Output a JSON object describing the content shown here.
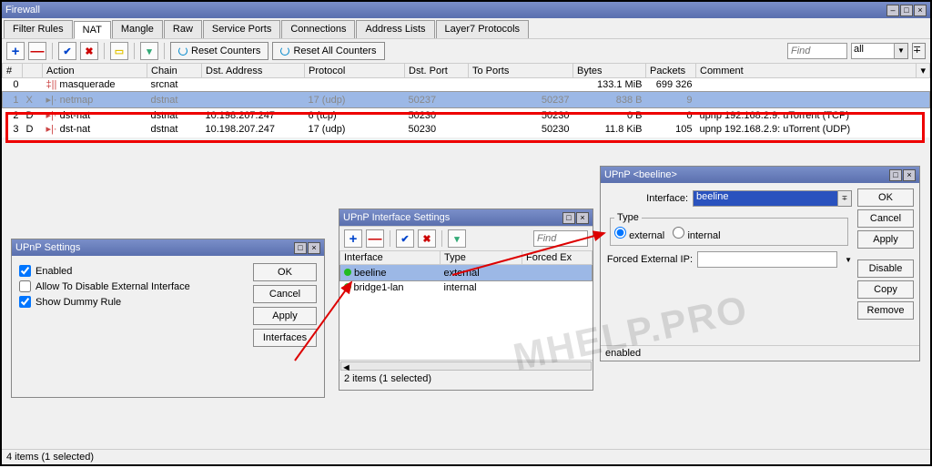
{
  "main": {
    "title": "Firewall",
    "tabs": [
      "Filter Rules",
      "NAT",
      "Mangle",
      "Raw",
      "Service Ports",
      "Connections",
      "Address Lists",
      "Layer7 Protocols"
    ],
    "activeTab": 1,
    "resetCounters": "Reset Counters",
    "resetAll": "Reset All Counters",
    "findPlaceholder": "Find",
    "filterAll": "all",
    "cols": [
      "#",
      "",
      "Action",
      "Chain",
      "Dst. Address",
      "Protocol",
      "Dst. Port",
      "To Ports",
      "Bytes",
      "Packets",
      "Comment"
    ],
    "rows": [
      {
        "n": "0",
        "f": "",
        "act": "masquerade",
        "chain": "srcnat",
        "da": "",
        "proto": "",
        "dp": "",
        "tp": "",
        "bytes": "133.1 MiB",
        "pkts": "699 326",
        "cm": "",
        "sel": false,
        "gray": false,
        "ico": "masq"
      },
      {
        "n": "1",
        "f": "X",
        "act": "netmap",
        "chain": "dstnat",
        "da": "",
        "proto": "17 (udp)",
        "dp": "50237",
        "tp": "50237",
        "bytes": "838 B",
        "pkts": "9",
        "cm": "",
        "sel": true,
        "gray": true,
        "ico": "net"
      },
      {
        "n": "2",
        "f": "D",
        "act": "dst-nat",
        "chain": "dstnat",
        "da": "10.198.207.247",
        "proto": "6 (tcp)",
        "dp": "50230",
        "tp": "50230",
        "bytes": "0 B",
        "pkts": "0",
        "cm": "upnp 192.168.2.9: uTorrent (TCP)",
        "sel": false,
        "gray": false,
        "ico": "dst"
      },
      {
        "n": "3",
        "f": "D",
        "act": "dst-nat",
        "chain": "dstnat",
        "da": "10.198.207.247",
        "proto": "17 (udp)",
        "dp": "50230",
        "tp": "50230",
        "bytes": "11.8 KiB",
        "pkts": "105",
        "cm": "upnp 192.168.2.9: uTorrent (UDP)",
        "sel": false,
        "gray": false,
        "ico": "dst"
      }
    ],
    "status": "4 items (1 selected)"
  },
  "upnpSettings": {
    "title": "UPnP Settings",
    "enabled": "Enabled",
    "allow": "Allow To Disable External Interface",
    "dummy": "Show Dummy Rule",
    "btns": {
      "ok": "OK",
      "cancel": "Cancel",
      "apply": "Apply",
      "interfaces": "Interfaces"
    }
  },
  "upnpIf": {
    "title": "UPnP Interface Settings",
    "findPlaceholder": "Find",
    "cols": [
      "Interface",
      "Type",
      "Forced Ex"
    ],
    "rows": [
      {
        "iface": "beeline",
        "type": "external",
        "sel": true
      },
      {
        "iface": "bridge1-lan",
        "type": "internal",
        "sel": false
      }
    ],
    "status": "2 items (1 selected)"
  },
  "upnpBeeline": {
    "title": "UPnP <beeline>",
    "ifaceLabel": "Interface:",
    "ifaceVal": "beeline",
    "typeLabel": "Type",
    "external": "external",
    "internal": "internal",
    "forcedLabel": "Forced External IP:",
    "btns": {
      "ok": "OK",
      "cancel": "Cancel",
      "apply": "Apply",
      "disable": "Disable",
      "copy": "Copy",
      "remove": "Remove"
    },
    "status": "enabled"
  },
  "watermark": "MHELP.PRO"
}
